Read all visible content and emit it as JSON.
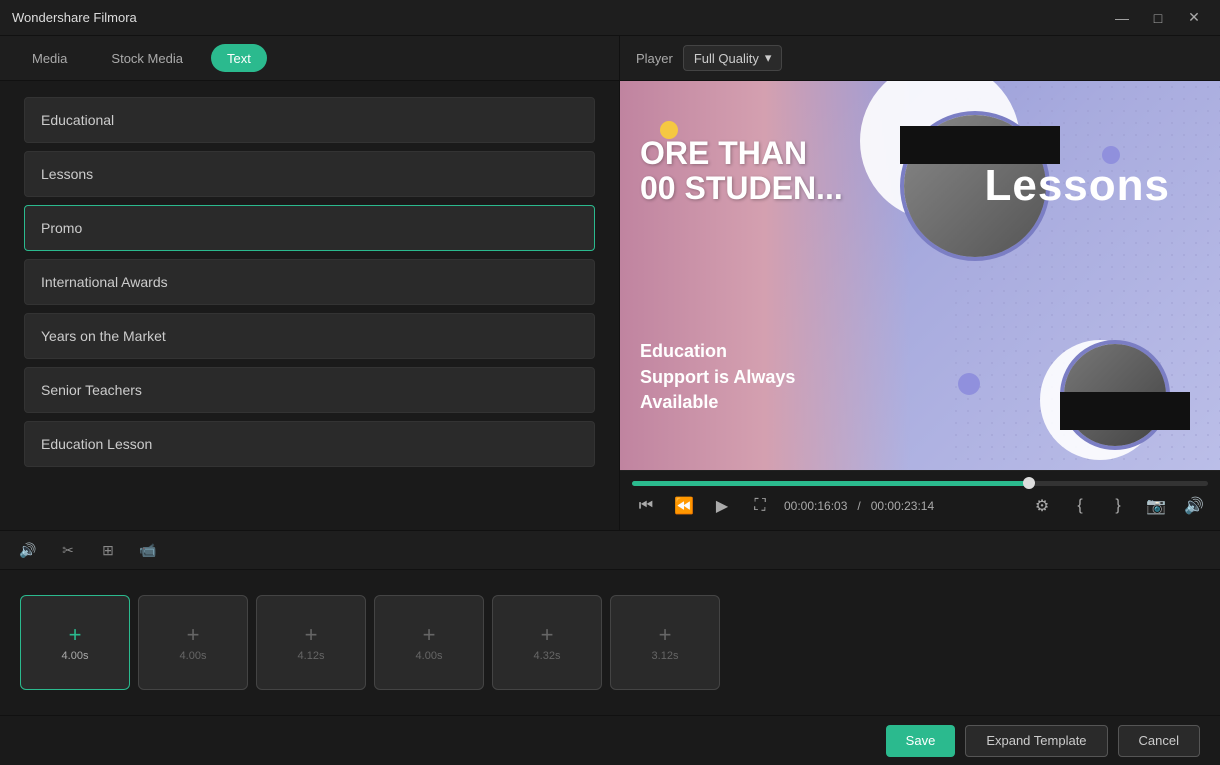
{
  "app": {
    "title": "Wondershare Filmora"
  },
  "titlebar": {
    "title": "Wondershare Filmora",
    "minimize": "—",
    "maximize": "□",
    "close": "✕"
  },
  "tabs": {
    "media": "Media",
    "stock_media": "Stock Media",
    "text": "Text"
  },
  "player": {
    "label": "Player",
    "quality_label": "Full Quality",
    "quality_dropdown_char": "▾"
  },
  "list_items": [
    {
      "id": "educational",
      "label": "Educational",
      "selected": false
    },
    {
      "id": "lessons",
      "label": "Lessons",
      "selected": false
    },
    {
      "id": "promo",
      "label": "Promo",
      "selected": true
    },
    {
      "id": "international-awards",
      "label": "International Awards",
      "selected": false
    },
    {
      "id": "years-on-market",
      "label": "Years on the Market",
      "selected": false
    },
    {
      "id": "senior-teachers",
      "label": "Senior Teachers",
      "selected": false
    },
    {
      "id": "education-lesson",
      "label": "Education Lesson",
      "selected": false
    }
  ],
  "preview": {
    "text_main_line1": "ORE THAN",
    "text_main_line2": "00 STUDEN...",
    "text_lessons": "Lessons",
    "text_sub_line1": "Education",
    "text_sub_line2": "Support is Always",
    "text_sub_line3": "Available"
  },
  "controls": {
    "time_current": "00:00:16:03",
    "time_total": "00:00:23:14",
    "time_separator": "/",
    "rewind_icon": "⏮",
    "back_icon": "⏪",
    "play_icon": "▶",
    "fullscreen_icon": "⛶",
    "settings_icon": "⚙",
    "bracket_open": "{",
    "bracket_close": "}",
    "camera_icon": "📷",
    "volume_icon": "🔊"
  },
  "toolbar": {
    "audio_icon": "🔊",
    "crop_icon": "✂",
    "transform_icon": "⊞",
    "camera_icon": "📹"
  },
  "timeline": {
    "clips": [
      {
        "duration": "4.00s",
        "selected": true
      },
      {
        "duration": "4.00s",
        "selected": false
      },
      {
        "duration": "4.12s",
        "selected": false
      },
      {
        "duration": "4.00s",
        "selected": false
      },
      {
        "duration": "4.32s",
        "selected": false
      },
      {
        "duration": "3.12s",
        "selected": false
      }
    ]
  },
  "buttons": {
    "save": "Save",
    "expand_template": "Expand Template",
    "cancel": "Cancel"
  }
}
